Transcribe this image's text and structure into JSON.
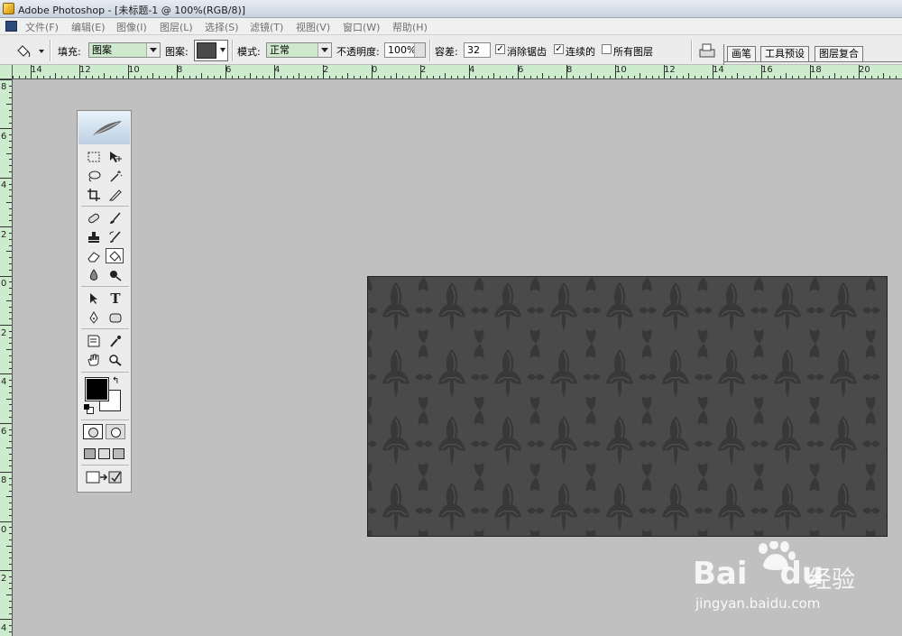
{
  "window": {
    "title": "Adobe Photoshop - [未标题-1 @ 100%(RGB/8)]"
  },
  "menu": {
    "items": [
      "文件(F)",
      "编辑(E)",
      "图像(I)",
      "图层(L)",
      "选择(S)",
      "滤镜(T)",
      "视图(V)",
      "窗口(W)",
      "帮助(H)"
    ]
  },
  "options": {
    "fill_label": "填充:",
    "fill_value": "图案",
    "pattern_label": "图案:",
    "mode_label": "模式:",
    "mode_value": "正常",
    "opacity_label": "不透明度:",
    "opacity_value": "100%",
    "tolerance_label": "容差:",
    "tolerance_value": "32",
    "antialias_label": "消除锯齿",
    "antialias_checked": true,
    "contiguous_label": "连续的",
    "contiguous_checked": true,
    "all_layers_label": "所有图层",
    "all_layers_checked": false,
    "palette_tabs": [
      "画笔",
      "工具预设",
      "图层复合"
    ]
  },
  "rulers": {
    "horizontal_labels": [
      "14",
      "12",
      "10",
      "8",
      "6",
      "4",
      "2",
      "0",
      "2",
      "4",
      "6",
      "8",
      "10",
      "12",
      "14",
      "16",
      "18",
      "20"
    ],
    "vertical_labels": [
      "8",
      "6",
      "4",
      "2",
      "0",
      "2",
      "4",
      "6",
      "8",
      "0",
      "2",
      "4"
    ]
  },
  "toolbox": {
    "tools": [
      "rect-marquee",
      "move",
      "lasso",
      "magic-wand",
      "crop",
      "slice",
      "healing",
      "brush",
      "clone-stamp",
      "history-brush",
      "eraser",
      "paint-bucket",
      "blur",
      "dodge",
      "path-select",
      "type",
      "pen",
      "shape",
      "notes",
      "eyedropper",
      "hand",
      "zoom"
    ],
    "selected_tool": "paint-bucket",
    "foreground_color": "#000000",
    "background_color": "#ffffff"
  },
  "canvas": {
    "fill": "damask pattern",
    "base_color": "#4a4a4a"
  },
  "watermark": {
    "brand": "Bai",
    "brand_suffix": "du",
    "cn_text": "经验",
    "url": "jingyan.baidu.com"
  }
}
